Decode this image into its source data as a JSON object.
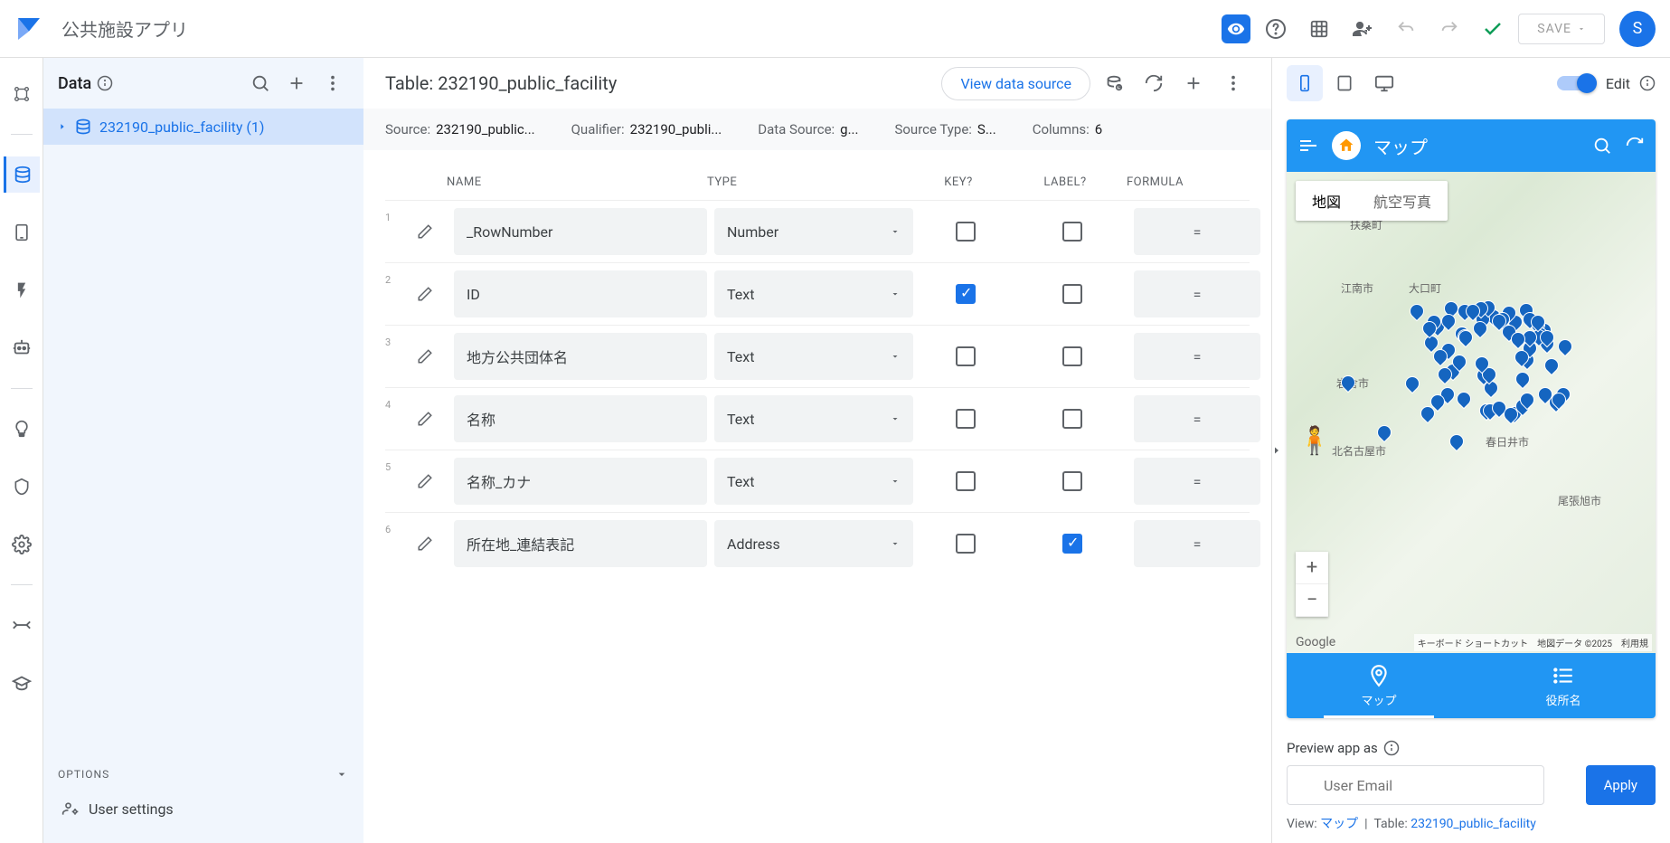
{
  "app_title": "公共施設アプリ",
  "header": {
    "save_label": "SAVE",
    "avatar_letter": "S"
  },
  "data_panel": {
    "title": "Data",
    "table_item": "232190_public_facility (1)",
    "options_label": "OPTIONS",
    "user_settings_label": "User settings"
  },
  "table": {
    "title": "Table: 232190_public_facility",
    "view_source_label": "View data source",
    "meta": {
      "source_label": "Source:",
      "source_value": "232190_public...",
      "qualifier_label": "Qualifier:",
      "qualifier_value": "232190_publi...",
      "datasource_label": "Data Source:",
      "datasource_value": "g...",
      "sourcetype_label": "Source Type:",
      "sourcetype_value": "S...",
      "columns_label": "Columns:",
      "columns_value": "6"
    },
    "headers": {
      "name": "NAME",
      "type": "TYPE",
      "key": "KEY?",
      "label": "LABEL?",
      "formula": "FORMULA"
    },
    "rows": [
      {
        "num": "1",
        "name": "_RowNumber",
        "type": "Number",
        "key": false,
        "label": false
      },
      {
        "num": "2",
        "name": "ID",
        "type": "Text",
        "key": true,
        "label": false
      },
      {
        "num": "3",
        "name": "地方公共団体名",
        "type": "Text",
        "key": false,
        "label": false
      },
      {
        "num": "4",
        "name": "名称",
        "type": "Text",
        "key": false,
        "label": false
      },
      {
        "num": "5",
        "name": "名称_カナ",
        "type": "Text",
        "key": false,
        "label": false
      },
      {
        "num": "6",
        "name": "所在地_連結表記",
        "type": "Address",
        "key": false,
        "label": true
      }
    ],
    "formula_symbol": "="
  },
  "preview": {
    "edit_label": "Edit",
    "map_title": "マップ",
    "map_tab_map": "地図",
    "map_tab_satellite": "航空写真",
    "bottom_tab_map": "マップ",
    "bottom_tab_list": "役所名",
    "preview_as_label": "Preview app as",
    "email_placeholder": "User Email",
    "apply_label": "Apply",
    "view_label": "View:",
    "view_value": "マップ",
    "table_label": "Table:",
    "table_value": "232190_public_facility",
    "attribution": "キーボード ショートカット　地図データ ©2025　利用規",
    "google_label": "Google",
    "map_places": [
      "扶桑町",
      "江南市",
      "大口町",
      "岩倉市",
      "北名古屋市",
      "春日井市",
      "尾張旭市"
    ]
  }
}
